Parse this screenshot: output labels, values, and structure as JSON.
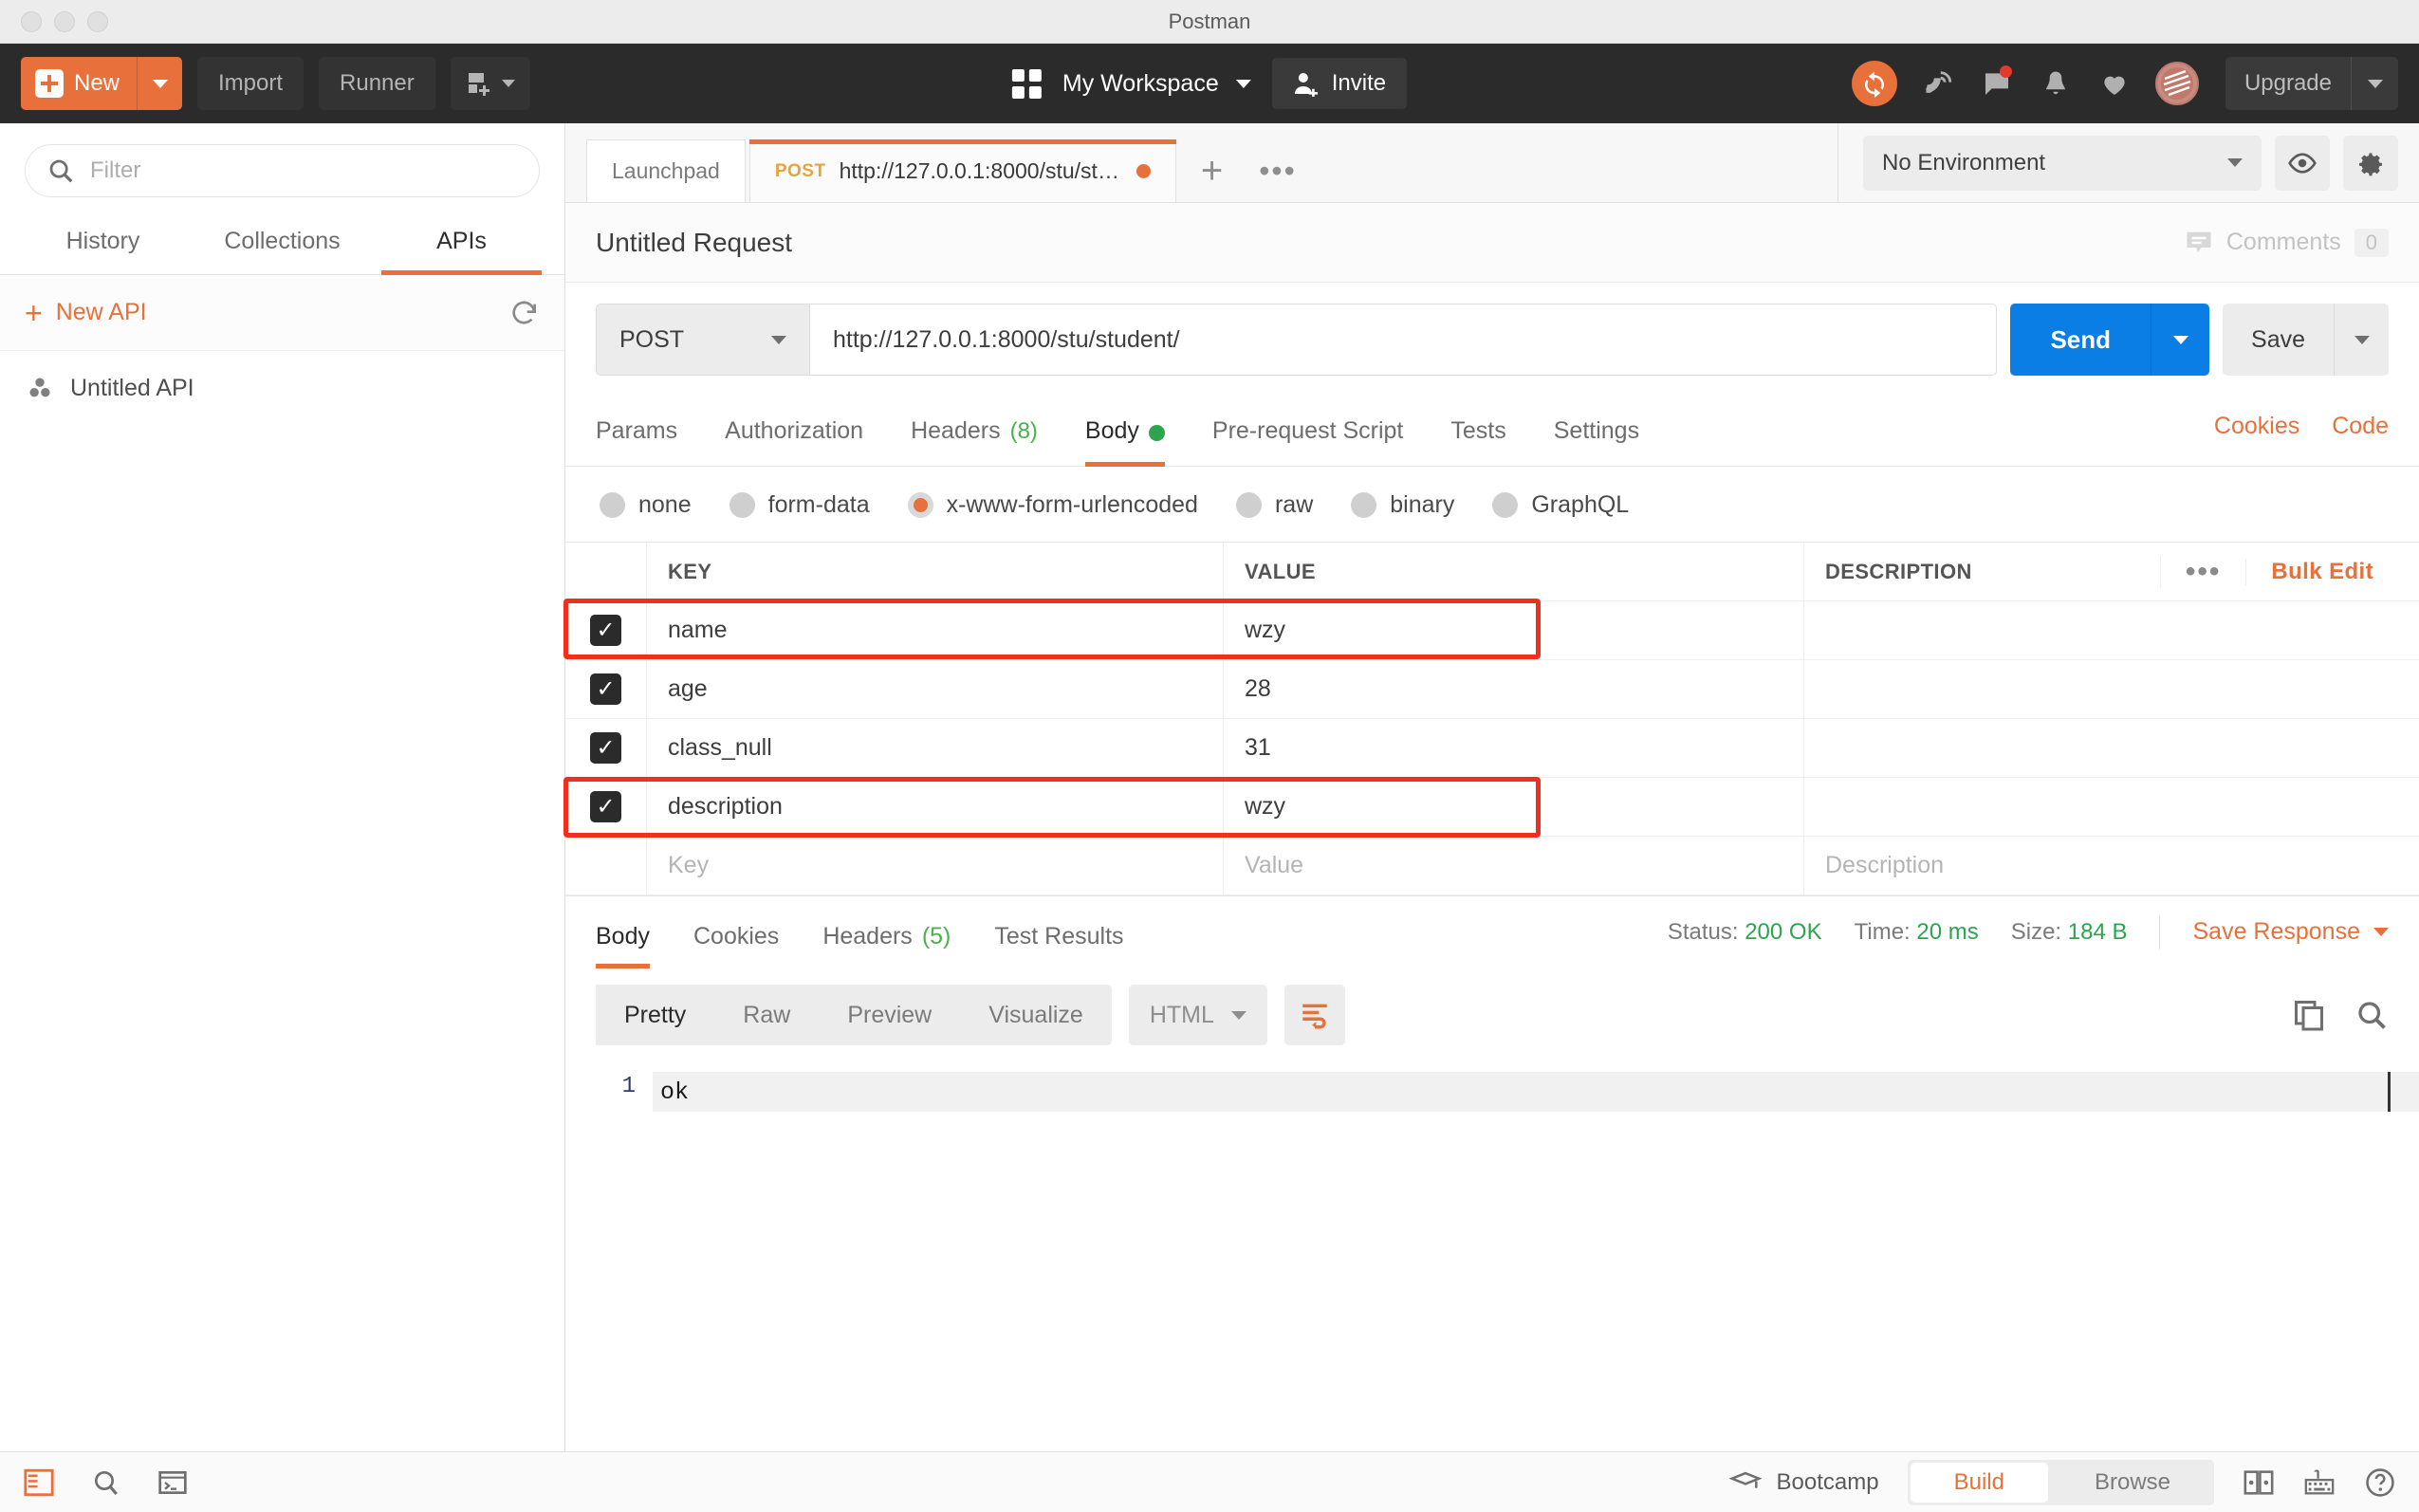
{
  "window": {
    "title": "Postman"
  },
  "header": {
    "new_button": "New",
    "import_button": "Import",
    "runner_button": "Runner",
    "workspace_name": "My Workspace",
    "invite_button": "Invite",
    "upgrade_button": "Upgrade",
    "icons": [
      "sync-icon",
      "satellite-icon",
      "comment-icon",
      "bell-icon",
      "heart-icon",
      "avatar"
    ],
    "accent_color": "#e8703a",
    "background_color": "#2b2b2b"
  },
  "sidebar": {
    "filter_placeholder": "Filter",
    "tabs": [
      {
        "label": "History",
        "active": false
      },
      {
        "label": "Collections",
        "active": false
      },
      {
        "label": "APIs",
        "active": true
      }
    ],
    "new_api_label": "New API",
    "items": [
      {
        "label": "Untitled API"
      }
    ]
  },
  "tabbar": {
    "tabs": [
      {
        "label": "Launchpad",
        "method": "",
        "active": false,
        "unsaved": false
      },
      {
        "label": "http://127.0.0.1:8000/stu/stud...",
        "method": "POST",
        "active": true,
        "unsaved": true
      }
    ],
    "add_label": "+",
    "more_label": "•••",
    "environment": "No Environment"
  },
  "request": {
    "title": "Untitled Request",
    "comments_label": "Comments",
    "comments_count": "0",
    "method": "POST",
    "url": "http://127.0.0.1:8000/stu/student/",
    "send_label": "Send",
    "save_label": "Save",
    "tabs": [
      {
        "label": "Params",
        "badge": "",
        "active": false
      },
      {
        "label": "Authorization",
        "badge": "",
        "active": false
      },
      {
        "label": "Headers",
        "badge": "(8)",
        "active": false
      },
      {
        "label": "Body",
        "badge": "",
        "active": true,
        "dot": true
      },
      {
        "label": "Pre-request Script",
        "badge": "",
        "active": false
      },
      {
        "label": "Tests",
        "badge": "",
        "active": false
      },
      {
        "label": "Settings",
        "badge": "",
        "active": false
      }
    ],
    "cookies_link": "Cookies",
    "code_link": "Code",
    "body_types": [
      {
        "label": "none",
        "selected": false
      },
      {
        "label": "form-data",
        "selected": false
      },
      {
        "label": "x-www-form-urlencoded",
        "selected": true
      },
      {
        "label": "raw",
        "selected": false
      },
      {
        "label": "binary",
        "selected": false
      },
      {
        "label": "GraphQL",
        "selected": false
      }
    ],
    "table": {
      "columns": [
        "KEY",
        "VALUE",
        "DESCRIPTION"
      ],
      "more_label": "•••",
      "bulk_edit_label": "Bulk Edit",
      "rows": [
        {
          "checked": true,
          "key": "name",
          "value": "wzy",
          "description": "",
          "highlighted": true
        },
        {
          "checked": true,
          "key": "age",
          "value": "28",
          "description": "",
          "highlighted": false
        },
        {
          "checked": true,
          "key": "class_null",
          "value": "31",
          "description": "",
          "highlighted": false
        },
        {
          "checked": true,
          "key": "description",
          "value": "wzy",
          "description": "",
          "highlighted": true
        }
      ],
      "placeholder_row": {
        "key": "Key",
        "value": "Value",
        "description": "Description"
      }
    }
  },
  "response": {
    "tabs": [
      {
        "label": "Body",
        "badge": "",
        "active": true
      },
      {
        "label": "Cookies",
        "badge": "",
        "active": false
      },
      {
        "label": "Headers",
        "badge": "(5)",
        "active": false
      },
      {
        "label": "Test Results",
        "badge": "",
        "active": false
      }
    ],
    "status_label": "Status:",
    "status_value": "200 OK",
    "time_label": "Time:",
    "time_value": "20 ms",
    "size_label": "Size:",
    "size_value": "184 B",
    "save_response_label": "Save Response",
    "view_modes": [
      {
        "label": "Pretty",
        "active": true
      },
      {
        "label": "Raw",
        "active": false
      },
      {
        "label": "Preview",
        "active": false
      },
      {
        "label": "Visualize",
        "active": false
      }
    ],
    "format": "HTML",
    "lines": [
      {
        "no": "1",
        "text": "ok"
      }
    ]
  },
  "footer": {
    "bootcamp_label": "Bootcamp",
    "build_label": "Build",
    "browse_label": "Browse"
  }
}
